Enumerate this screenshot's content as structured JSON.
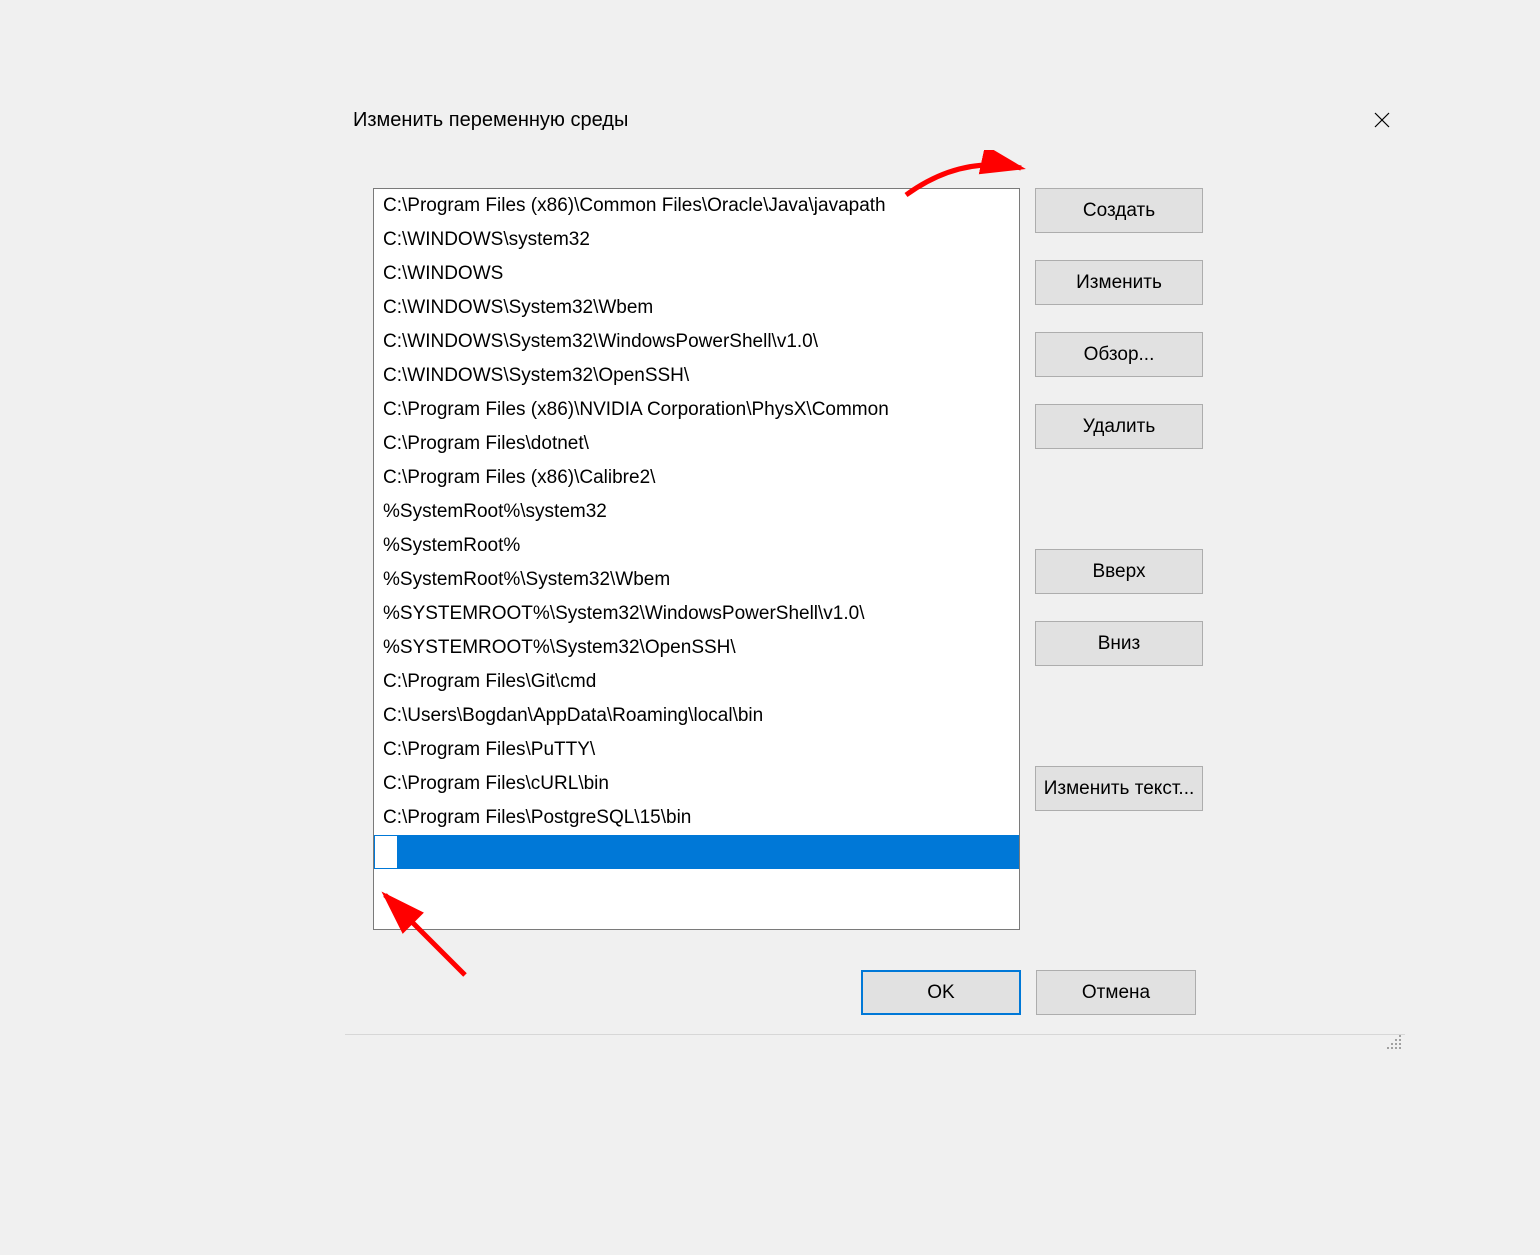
{
  "dialog": {
    "title": "Изменить переменную среды",
    "close_label": "Close"
  },
  "path_entries": [
    "C:\\Program Files (x86)\\Common Files\\Oracle\\Java\\javapath",
    "C:\\WINDOWS\\system32",
    "C:\\WINDOWS",
    "C:\\WINDOWS\\System32\\Wbem",
    "C:\\WINDOWS\\System32\\WindowsPowerShell\\v1.0\\",
    "C:\\WINDOWS\\System32\\OpenSSH\\",
    "C:\\Program Files (x86)\\NVIDIA Corporation\\PhysX\\Common",
    "C:\\Program Files\\dotnet\\",
    "C:\\Program Files (x86)\\Calibre2\\",
    "%SystemRoot%\\system32",
    "%SystemRoot%",
    "%SystemRoot%\\System32\\Wbem",
    "%SYSTEMROOT%\\System32\\WindowsPowerShell\\v1.0\\",
    "%SYSTEMROOT%\\System32\\OpenSSH\\",
    "C:\\Program Files\\Git\\cmd",
    "C:\\Users\\Bogdan\\AppData\\Roaming\\local\\bin",
    "C:\\Program Files\\PuTTY\\",
    "C:\\Program Files\\cURL\\bin",
    "C:\\Program Files\\PostgreSQL\\15\\bin"
  ],
  "new_entry_value": "",
  "buttons": {
    "new": "Создать",
    "edit": "Изменить",
    "browse": "Обзор...",
    "delete": "Удалить",
    "move_up": "Вверх",
    "move_down": "Вниз",
    "edit_text": "Изменить текст...",
    "ok": "OK",
    "cancel": "Отмена"
  },
  "annotations": {
    "arrow_top": true,
    "arrow_bottom": true
  },
  "colors": {
    "selection": "#0078d7",
    "button_face": "#e1e1e1",
    "button_border": "#adadad",
    "window_bg": "#f0f0f0",
    "arrow": "#ff0000"
  }
}
